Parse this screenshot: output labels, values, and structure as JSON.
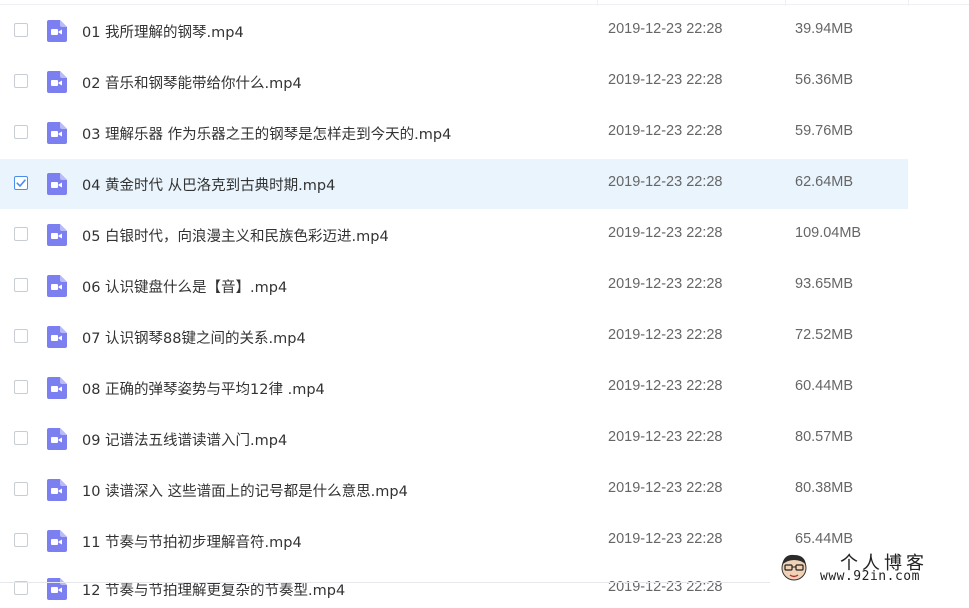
{
  "files": [
    {
      "name": "01 我所理解的钢琴.mp4",
      "date": "2019-12-23 22:28",
      "size": "39.94MB",
      "checked": false
    },
    {
      "name": "02 音乐和钢琴能带给你什么.mp4",
      "date": "2019-12-23 22:28",
      "size": "56.36MB",
      "checked": false
    },
    {
      "name": "03 理解乐器 作为乐器之王的钢琴是怎样走到今天的.mp4",
      "date": "2019-12-23 22:28",
      "size": "59.76MB",
      "checked": false
    },
    {
      "name": "04 黄金时代 从巴洛克到古典时期.mp4",
      "date": "2019-12-23 22:28",
      "size": "62.64MB",
      "checked": true
    },
    {
      "name": "05 白银时代，向浪漫主义和民族色彩迈进.mp4",
      "date": "2019-12-23 22:28",
      "size": "109.04MB",
      "checked": false
    },
    {
      "name": "06 认识键盘什么是【音】.mp4",
      "date": "2019-12-23 22:28",
      "size": "93.65MB",
      "checked": false
    },
    {
      "name": "07 认识钢琴88键之间的关系.mp4",
      "date": "2019-12-23 22:28",
      "size": "72.52MB",
      "checked": false
    },
    {
      "name": "08 正确的弹琴姿势与平均12律 .mp4",
      "date": "2019-12-23 22:28",
      "size": "60.44MB",
      "checked": false
    },
    {
      "name": "09 记谱法五线谱读谱入门.mp4",
      "date": "2019-12-23 22:28",
      "size": "80.57MB",
      "checked": false
    },
    {
      "name": "10 读谱深入 这些谱面上的记号都是什么意思.mp4",
      "date": "2019-12-23 22:28",
      "size": "80.38MB",
      "checked": false
    },
    {
      "name": "11 节奏与节拍初步理解音符.mp4",
      "date": "2019-12-23 22:28",
      "size": "65.44MB",
      "checked": false
    },
    {
      "name": "12 节奏与节拍理解更复杂的节奏型.mp4",
      "date": "2019-12-23 22:28",
      "size": "",
      "checked": false
    }
  ],
  "icons": {
    "file_icon": "video-file-icon",
    "checkbox": "checkbox",
    "check": "checkmark-icon"
  },
  "colors": {
    "file_icon": "#7b7ff0",
    "selected_row_bg": "#e9f4fd",
    "checkbox_checked": "#4a8df0"
  },
  "watermark": {
    "title": "个人博客",
    "url": "www.92in.com"
  }
}
